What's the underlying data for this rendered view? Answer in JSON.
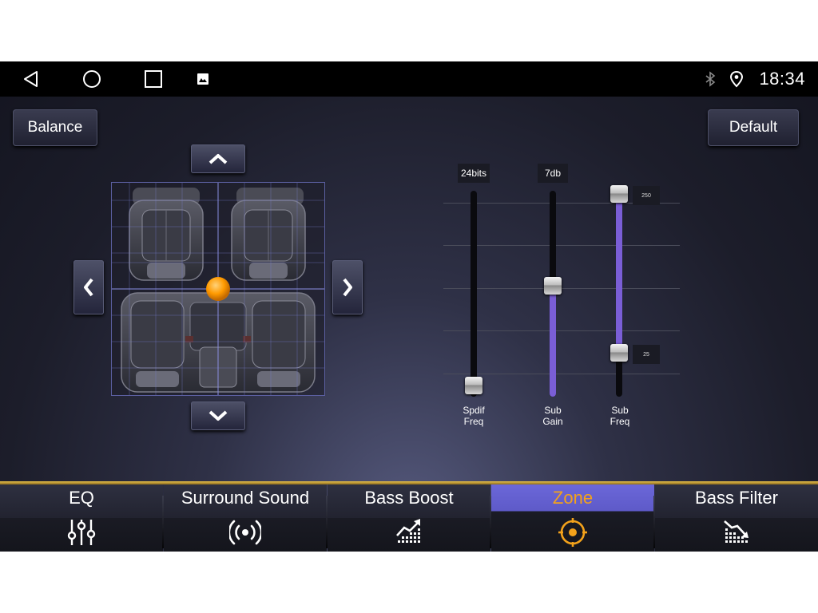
{
  "statusbar": {
    "time": "18:34",
    "icons": [
      "back-icon",
      "home-icon",
      "recents-icon",
      "image-icon",
      "bluetooth-icon",
      "location-icon"
    ]
  },
  "buttons": {
    "balance_label": "Balance",
    "default_label": "Default"
  },
  "seatmap": {
    "icons": [
      "arrow-up-icon",
      "arrow-down-icon",
      "arrow-left-icon",
      "arrow-right-icon"
    ],
    "balance_point_color": "#ff9a00"
  },
  "sliders": [
    {
      "id": "spdif-freq",
      "top_label": "24bits",
      "caption_line1": "Spdif",
      "caption_line2": "Freq",
      "level": 0.0
    },
    {
      "id": "sub-gain",
      "top_label": "7db",
      "caption_line1": "Sub",
      "caption_line2": "Gain",
      "level": 0.52
    },
    {
      "id": "sub-freq",
      "top_label": "",
      "caption_line1": "Sub",
      "caption_line2": "Freq",
      "range_high": "250",
      "range_low": "25",
      "level_high": 1.0,
      "level_low": 0.17
    }
  ],
  "tabs": [
    {
      "label": "EQ",
      "icon": "equalizer-icon",
      "active": false
    },
    {
      "label": "Surround Sound",
      "icon": "surround-icon",
      "active": false
    },
    {
      "label": "Bass Boost",
      "icon": "bass-boost-icon",
      "active": false
    },
    {
      "label": "Zone",
      "icon": "zone-target-icon",
      "active": true
    },
    {
      "label": "Bass Filter",
      "icon": "bass-filter-icon",
      "active": false
    }
  ],
  "colors": {
    "accent_active_tab": "#5e5ac8",
    "active_tab_text": "#f3a21b",
    "slider_fill": "#7a5ed6",
    "tabbar_line": "#e9c24a"
  }
}
